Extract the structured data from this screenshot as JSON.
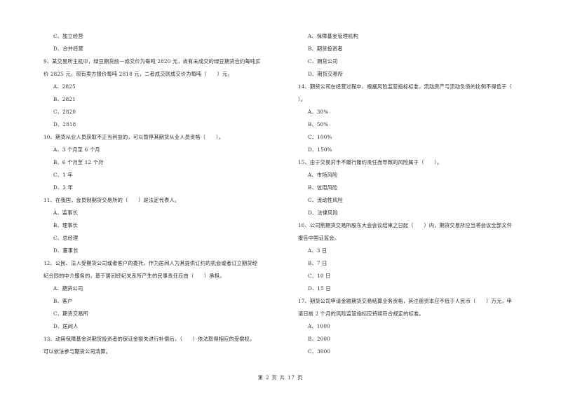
{
  "left_column": {
    "q8_tail_options": [
      {
        "label": "C、独立经营"
      },
      {
        "label": "D、合并经营"
      }
    ],
    "q9": {
      "line1": "9、某交易所主机中，绿豆期货前一成交价为每吨 2820 元，尚有未成交的绿豆期货合约每吨买",
      "line2": "价 2825 元，现有卖方报价每吨 2818 元，二者成交则成交价为每吨（　　）元。",
      "options": [
        "A、2825",
        "B、2821",
        "C、2820",
        "D、2818"
      ]
    },
    "q10": {
      "line1": "10、期货从业人员获取不正当利益的，可以暂停其期货从业人员资格（　　）。",
      "options": [
        "A、3 个月至 6 个月",
        "B、6 个月至 12 个月",
        "C、1 年",
        "D、2 年"
      ]
    },
    "q11": {
      "line1": "11、在我国，会员制期货交易所的（　　）是法定代表人。",
      "options": [
        "A、监事长",
        "B、理事长",
        "C、总经理",
        "D、董事长"
      ]
    },
    "q12": {
      "line1": "12、公民、法人受期货公司或者客户的委托，作为居间人为其提供订约的机会或者订立期货经",
      "line2": "纪合同的中介服务的，基于居间经纪关系所产生的民事责任应由（　　）承担。",
      "options": [
        "A、期货公司",
        "B、客户",
        "C、期货交易所",
        "D、居间人"
      ]
    },
    "q13": {
      "line1": "13、动用保障基金对期货投资者的保证金损失进行补偿后，（　　）依法取得相应的受偿权，",
      "line2": "可以依法参与期货公司清算。"
    }
  },
  "right_column": {
    "q13_options": [
      "A、保障基金管理机构",
      "B、期货投资者",
      "C、期货公司",
      "D、期货交易所"
    ],
    "q14": {
      "line1": "14、期货公司在经营过程中，根据风险监管指标标准，流动资产与流动负债的比例不得低于（",
      "line2": "）。",
      "options": [
        "A、30%",
        "B、50%",
        "C、100%",
        "D、150%"
      ]
    },
    "q15": {
      "line1": "15、由于交易对手不履行履约责任而导致的风险属于（　　）。",
      "options": [
        "A、市场风险",
        "B、信用风险",
        "C、流动性风险",
        "D、法律风险"
      ]
    },
    "q16": {
      "line1": "16、公司制期货交易所股东大会会议结束之日起（　　）内，期货交易所应当将会议全部文件",
      "line2": "报告中国证监会。",
      "options": [
        "A、3 日",
        "B、7 日",
        "C、10 日",
        "D、15 日"
      ]
    },
    "q17": {
      "line1": "17、期货公司申请金融期货交易结算业务资格，其注册资本应不低于人民币（　　）万元，申",
      "line2": "请日前 2 个月的风险监管指标应持续符合规定的标准。",
      "options": [
        "A、1000",
        "B、2000",
        "C、3000"
      ]
    }
  },
  "footer": {
    "page_indicator": "第 2 页 共 17 页"
  }
}
